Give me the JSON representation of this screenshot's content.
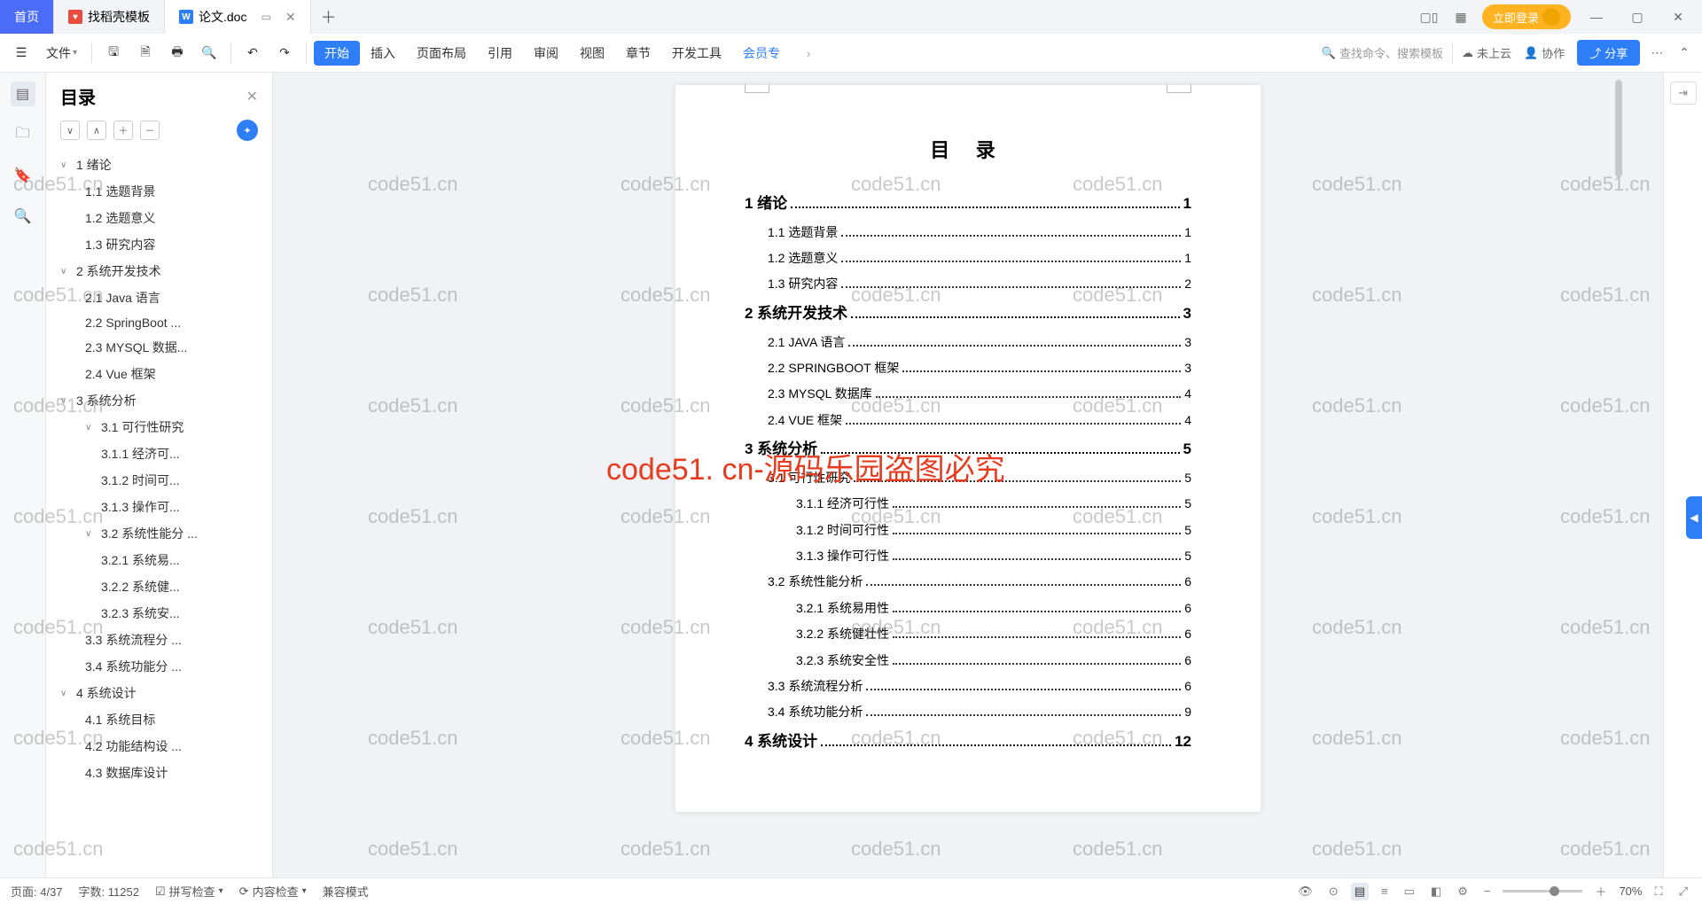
{
  "tabs": {
    "home": "首页",
    "t1": "找稻壳模板",
    "active": "论文.doc"
  },
  "titlebar": {
    "login": "立即登录"
  },
  "toolbar": {
    "file": "文件",
    "menus": [
      "开始",
      "插入",
      "页面布局",
      "引用",
      "审阅",
      "视图",
      "章节",
      "开发工具",
      "会员专"
    ],
    "search_placeholder": "查找命令、搜索模板",
    "cloud": "未上云",
    "collab": "协作",
    "share": "分享"
  },
  "outline": {
    "title": "目录",
    "items": [
      {
        "lv": 0,
        "chev": "∨",
        "text": "1  绪论"
      },
      {
        "lv": 1,
        "text": "1.1  选题背景"
      },
      {
        "lv": 1,
        "text": "1.2  选题意义"
      },
      {
        "lv": 1,
        "text": "1.3  研究内容"
      },
      {
        "lv": 0,
        "chev": "∨",
        "text": "2  系统开发技术"
      },
      {
        "lv": 1,
        "text": "2.1 Java 语言"
      },
      {
        "lv": 1,
        "text": "2.2 SpringBoot ..."
      },
      {
        "lv": 1,
        "text": "2.3 MYSQL 数据..."
      },
      {
        "lv": 1,
        "text": "2.4 Vue 框架"
      },
      {
        "lv": 0,
        "chev": "∨",
        "text": "3  系统分析"
      },
      {
        "lv": 1,
        "chev": "∨",
        "text": "3.1 可行性研究"
      },
      {
        "lv": 2,
        "text": "3.1.1 经济可..."
      },
      {
        "lv": 2,
        "text": "3.1.2 时间可..."
      },
      {
        "lv": 2,
        "text": "3.1.3 操作可..."
      },
      {
        "lv": 1,
        "chev": "∨",
        "text": "3.2 系统性能分 ..."
      },
      {
        "lv": 2,
        "text": "3.2.1 系统易..."
      },
      {
        "lv": 2,
        "text": "3.2.2 系统健..."
      },
      {
        "lv": 2,
        "text": "3.2.3 系统安..."
      },
      {
        "lv": 1,
        "text": "3.3 系统流程分 ..."
      },
      {
        "lv": 1,
        "text": "3.4 系统功能分 ..."
      },
      {
        "lv": 0,
        "chev": "∨",
        "text": "4  系统设计"
      },
      {
        "lv": 1,
        "text": "4.1 系统目标"
      },
      {
        "lv": 1,
        "text": "4.2 功能结构设 ..."
      },
      {
        "lv": 1,
        "text": "4.3 数据库设计"
      }
    ]
  },
  "document": {
    "toc_title": "目 录",
    "rows": [
      {
        "level": "h1",
        "label": "1  绪论",
        "page": "1"
      },
      {
        "level": "h2",
        "label": "1.1 选题背景",
        "page": "1"
      },
      {
        "level": "h2",
        "label": "1.2 选题意义",
        "page": "1"
      },
      {
        "level": "h2",
        "label": "1.3 研究内容",
        "page": "2"
      },
      {
        "level": "h1",
        "label": "2  系统开发技术",
        "page": "3"
      },
      {
        "level": "h2",
        "label": "2.1 JAVA 语言",
        "page": "3"
      },
      {
        "level": "h2",
        "label": "2.2 SPRINGBOOT 框架",
        "page": "3"
      },
      {
        "level": "h2",
        "label": "2.3 MYSQL 数据库",
        "page": "4"
      },
      {
        "level": "h2",
        "label": "2.4 VUE 框架",
        "page": "4"
      },
      {
        "level": "h1",
        "label": "3  系统分析",
        "page": "5"
      },
      {
        "level": "h2",
        "label": "3.1 可行性研究",
        "page": "5"
      },
      {
        "level": "h3",
        "label": "3.1.1 经济可行性",
        "page": "5"
      },
      {
        "level": "h3",
        "label": "3.1.2 时间可行性",
        "page": "5"
      },
      {
        "level": "h3",
        "label": "3.1.3 操作可行性",
        "page": "5"
      },
      {
        "level": "h2",
        "label": "3.2 系统性能分析",
        "page": "6"
      },
      {
        "level": "h3",
        "label": "3.2.1 系统易用性",
        "page": "6"
      },
      {
        "level": "h3",
        "label": "3.2.2 系统健壮性",
        "page": "6"
      },
      {
        "level": "h3",
        "label": "3.2.3 系统安全性",
        "page": "6"
      },
      {
        "level": "h2",
        "label": "3.3 系统流程分析",
        "page": "6"
      },
      {
        "level": "h2",
        "label": "3.4 系统功能分析",
        "page": "9"
      },
      {
        "level": "h1",
        "label": "4  系统设计",
        "page": "12"
      }
    ]
  },
  "statusbar": {
    "page": "页面: 4/37",
    "words": "字数: 11252",
    "spell": "拼写检查",
    "content": "内容检查",
    "compat": "兼容模式",
    "zoom": "70%"
  },
  "watermarks": {
    "text": "code51.cn",
    "redtext": "code51. cn-源码乐园盗图必究"
  }
}
